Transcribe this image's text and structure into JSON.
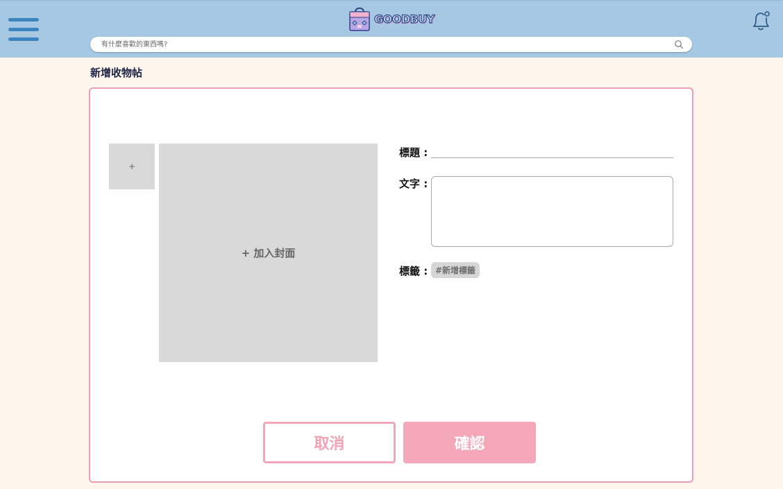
{
  "header": {
    "logo_text": "GOODBUY",
    "search_placeholder": "有什麼喜歡的東西嗎?"
  },
  "page": {
    "title": "新增收物帖"
  },
  "form": {
    "thumb_add_label": "+",
    "cover_add_label": "+ 加入封面",
    "title_label": "標題 :",
    "title_value": "",
    "text_label": "文字 :",
    "text_value": "",
    "tags_label": "標籤 :",
    "tag_chip": "#新增標籤"
  },
  "actions": {
    "cancel_label": "取消",
    "confirm_label": "確認"
  },
  "colors": {
    "header_bg": "#a6c8e2",
    "page_bg": "#fdf6ec",
    "accent_pink": "#f4a7b8",
    "menu_blue": "#3b84bf"
  },
  "icons": {
    "menu": "hamburger-menu-icon",
    "logo": "shopping-bag-icon",
    "notifications": "bell-icon",
    "search": "search-icon"
  }
}
